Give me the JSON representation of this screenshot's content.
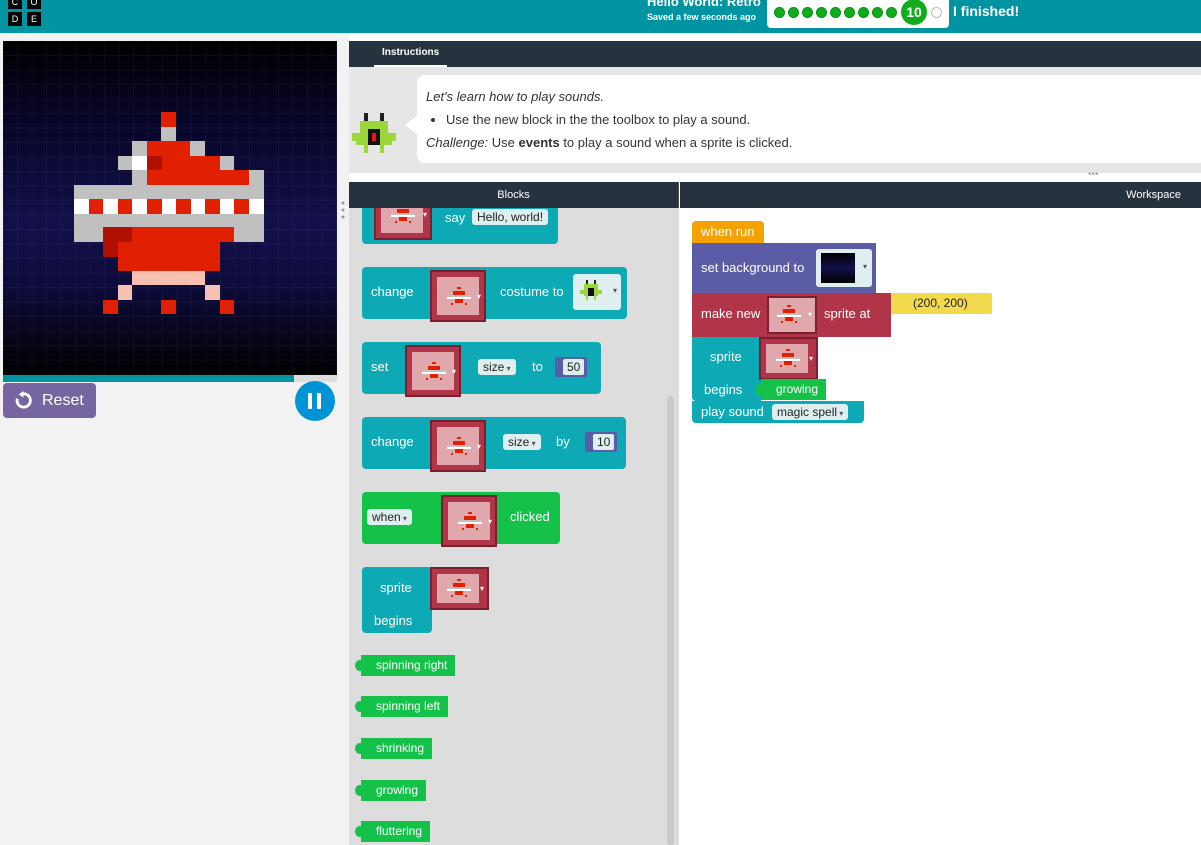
{
  "header": {
    "logo_letters": [
      "C",
      "O",
      "D",
      "E"
    ],
    "project_title": "Hello World: Retro",
    "save_status": "Saved a few seconds ago",
    "progress": {
      "completed_dots": 9,
      "current_level": "10",
      "finished_label": "I finished!"
    },
    "accent_color": "#0094a3"
  },
  "stage": {
    "reset_label": "Reset",
    "playback_progress": 0.87,
    "icons": {
      "reset": "reset-icon",
      "pause": "pause-icon"
    }
  },
  "instructions": {
    "tab_label": "Instructions",
    "intro": "Let's learn how to play sounds.",
    "bullet": "Use the new block in the the toolbox to play a sound.",
    "challenge_prefix": "Challenge:",
    "challenge_before": " Use ",
    "challenge_bold": "events",
    "challenge_after": " to play a sound when a sprite is clicked."
  },
  "toolbox": {
    "header": "Blocks",
    "blocks": {
      "say": {
        "label": "say",
        "value": "Hello, world!"
      },
      "change_costume": {
        "label": "change",
        "label2": "costume to"
      },
      "set_size": {
        "label": "set",
        "prop": "size",
        "label2": "to",
        "value": "50"
      },
      "change_size": {
        "label": "change",
        "prop": "size",
        "label2": "by",
        "value": "10"
      },
      "when_clicked": {
        "event": "when",
        "label": "clicked"
      },
      "sprite_begins": {
        "label": "sprite",
        "label2": "begins"
      },
      "behaviors": [
        "spinning right",
        "spinning left",
        "shrinking",
        "growing",
        "fluttering"
      ]
    }
  },
  "workspace": {
    "header": "Workspace",
    "when_run": "when run",
    "set_background": "set background to",
    "make_new": "make new",
    "sprite_at": "sprite at",
    "location": "(200, 200)",
    "sprite": "sprite",
    "begins": "begins",
    "behavior": "growing",
    "play_sound": "play sound",
    "sound": "magic spell"
  }
}
